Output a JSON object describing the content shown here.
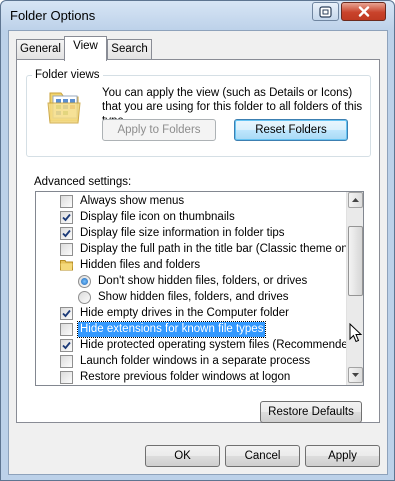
{
  "window": {
    "title": "Folder Options",
    "help_icon": "help-icon",
    "close_icon": "close-icon"
  },
  "tabs": [
    {
      "label": "General",
      "active": false
    },
    {
      "label": "View",
      "active": true
    },
    {
      "label": "Search",
      "active": false
    }
  ],
  "folder_views": {
    "legend": "Folder views",
    "icon": "folder-view-icon",
    "description": "You can apply the view (such as Details or Icons) that you are using for this folder to all folders of this type.",
    "apply_button": "Apply to Folders",
    "reset_button": "Reset Folders"
  },
  "advanced": {
    "label": "Advanced settings:",
    "items": [
      {
        "type": "checkbox",
        "label": "Always show menus",
        "checked": false
      },
      {
        "type": "checkbox",
        "label": "Display file icon on thumbnails",
        "checked": true
      },
      {
        "type": "checkbox",
        "label": "Display file size information in folder tips",
        "checked": true
      },
      {
        "type": "checkbox",
        "label": "Display the full path in the title bar (Classic theme only)",
        "checked": false
      },
      {
        "type": "folder",
        "label": "Hidden files and folders"
      },
      {
        "type": "radio",
        "label": "Don't show hidden files, folders, or drives",
        "checked": true
      },
      {
        "type": "radio",
        "label": "Show hidden files, folders, and drives",
        "checked": false
      },
      {
        "type": "checkbox",
        "label": "Hide empty drives in the Computer folder",
        "checked": true
      },
      {
        "type": "checkbox",
        "label": "Hide extensions for known file types",
        "checked": false,
        "selected": true
      },
      {
        "type": "checkbox",
        "label": "Hide protected operating system files (Recommended)",
        "checked": true
      },
      {
        "type": "checkbox",
        "label": "Launch folder windows in a separate process",
        "checked": false
      },
      {
        "type": "checkbox",
        "label": "Restore previous folder windows at logon",
        "checked": false
      }
    ]
  },
  "buttons": {
    "restore_defaults": "Restore Defaults",
    "ok": "OK",
    "cancel": "Cancel",
    "apply": "Apply"
  },
  "colors": {
    "selection": "#3399ff",
    "title_bar": "#bcd1e9",
    "close_button": "#c9432b"
  }
}
